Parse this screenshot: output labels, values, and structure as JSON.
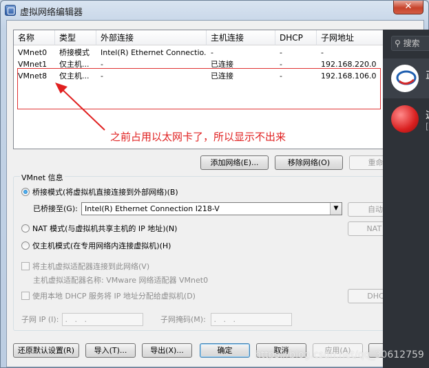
{
  "window": {
    "title": "虚拟网络编辑器",
    "close_label": "✕"
  },
  "table": {
    "headers": [
      "名称",
      "类型",
      "外部连接",
      "主机连接",
      "DHCP",
      "子网地址"
    ],
    "rows": [
      [
        "VMnet0",
        "桥接模式",
        "Intel(R) Ethernet Connectio...",
        "-",
        "-",
        "-"
      ],
      [
        "VMnet1",
        "仅主机...",
        "-",
        "已连接",
        "-",
        "192.168.220.0"
      ],
      [
        "VMnet8",
        "仅主机...",
        "-",
        "已连接",
        "-",
        "192.168.106.0"
      ]
    ]
  },
  "annotation": {
    "text": "之前占用以太网卡了，所以显示不出来",
    "color": "#e02020"
  },
  "list_buttons": {
    "add": "添加网络(E)...",
    "remove": "移除网络(O)",
    "rename": "重命名网"
  },
  "vmnet_info": {
    "title": "VMnet 信息",
    "bridged": "桥接模式(将虚拟机直接连接到外部网络)(B)",
    "bridged_to_label": "已桥接至(G):",
    "bridged_to_value": "Intel(R) Ethernet Connection I218-V",
    "auto_settings": "自动设置",
    "nat": "NAT 模式(与虚拟机共享主机的 IP 地址)(N)",
    "nat_settings": "NAT 设置",
    "host_only": "仅主机模式(在专用网络内连接虚拟机)(H)",
    "connect_adapter": "将主机虚拟适配器连接到此网络(V)",
    "adapter_name": "主机虚拟适配器名称: VMware 网络适配器 VMnet0",
    "use_dhcp": "使用本地 DHCP 服务将 IP 地址分配给虚拟机(D)",
    "dhcp_settings": "DHCP 设",
    "subnet_ip_label": "子网 IP (I):",
    "subnet_mask_label": "子网掩码(M):",
    "ip_placeholder": " .   .   . "
  },
  "bottom_buttons": {
    "restore": "还原默认设置(R)",
    "import": "导入(T)...",
    "export": "导出(X)...",
    "ok": "确定",
    "cancel": "取消",
    "apply": "应用(A)"
  },
  "side_panel": {
    "search": "搜索",
    "item1_text": "正",
    "item2_text": "这",
    "item2_sub": "["
  },
  "watermark": "https://blog.csdn.net/qq_30612759",
  "colors": {
    "accent": "#3c7fb1",
    "annotation": "#e02020",
    "side_bg": "#2e3238"
  }
}
